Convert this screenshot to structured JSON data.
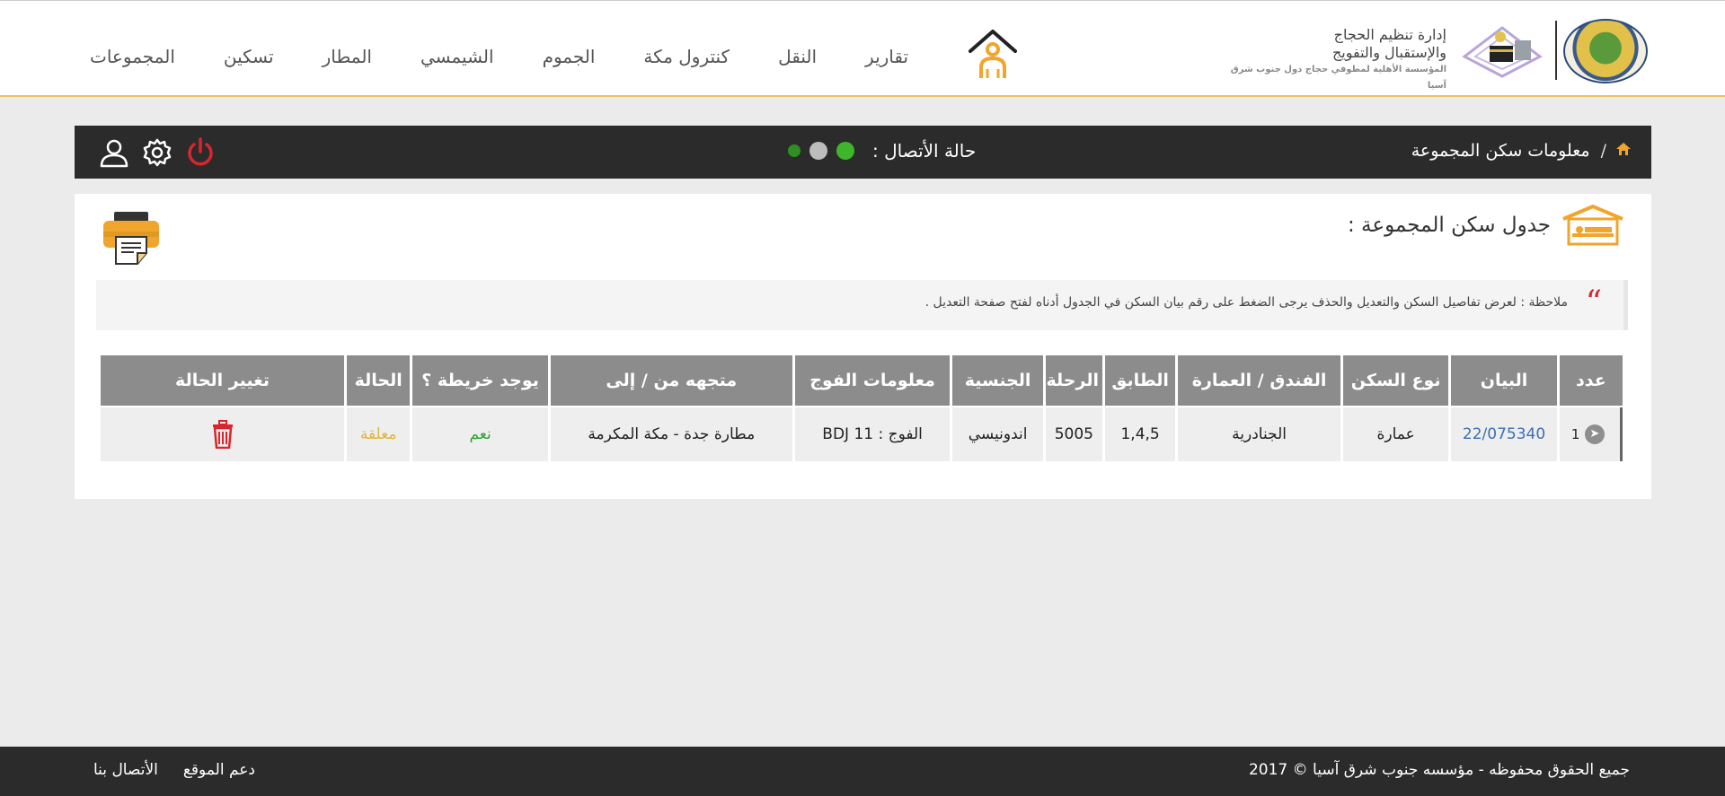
{
  "header": {
    "logo": {
      "line1": "إدارة تنظيم الحجاج",
      "line2": "والإستقبال والتفويج",
      "line3": "المؤسسة الأهلية لمطوفي حجاج دول جنوب شرق آسيا"
    },
    "nav": [
      "المجموعات",
      "تسكين",
      "المطار",
      "الشيمسي",
      "الجموم",
      "كنترول مكة",
      "النقل",
      "تقارير"
    ]
  },
  "bar": {
    "breadcrumb": "معلومات سكن المجموعة",
    "status_label": "حالة الأتصال :"
  },
  "section": {
    "title": "جدول سكن المجموعة :",
    "note": "ملاحظة : لعرض تفاصيل السكن والتعديل والحذف يرجى الضغط على رقم بيان السكن في الجدول أدناه لفتح صفحة التعديل ."
  },
  "table": {
    "headers": [
      "عدد",
      "البيان",
      "نوع السكن",
      "الفندق / العمارة",
      "الطابق",
      "الرحلة",
      "الجنسية",
      "معلومات الفوج",
      "متجهه من / إلى",
      "يوجد خريطة ؟",
      "الحالة",
      "تغيير الحالة"
    ],
    "rows": [
      {
        "count": "1",
        "statement": "22/075340",
        "housing_type": "عمارة",
        "hotel": "الجنادرية",
        "floor": "1,4,5",
        "flight": "5005",
        "nationality": "اندونيسي",
        "group_info": "الفوج : BDJ 11",
        "direction": "مطارة جدة - مكة المكرمة",
        "has_map": "نعم",
        "status": "معلقة"
      }
    ]
  },
  "footer": {
    "copyright": "جميع الحقوق محفوظه - مؤسسه جنوب شرق آسيا © 2017",
    "contact": "الأتصال بنا",
    "support": "دعم الموقع"
  },
  "colors": {
    "accent": "#f0a52c",
    "dark": "#2b2b2b",
    "header_cell": "#8c8c8c",
    "link": "#3b6fb3",
    "yes": "#2fa32f",
    "pending": "#e2b535",
    "danger": "#d8262c"
  }
}
